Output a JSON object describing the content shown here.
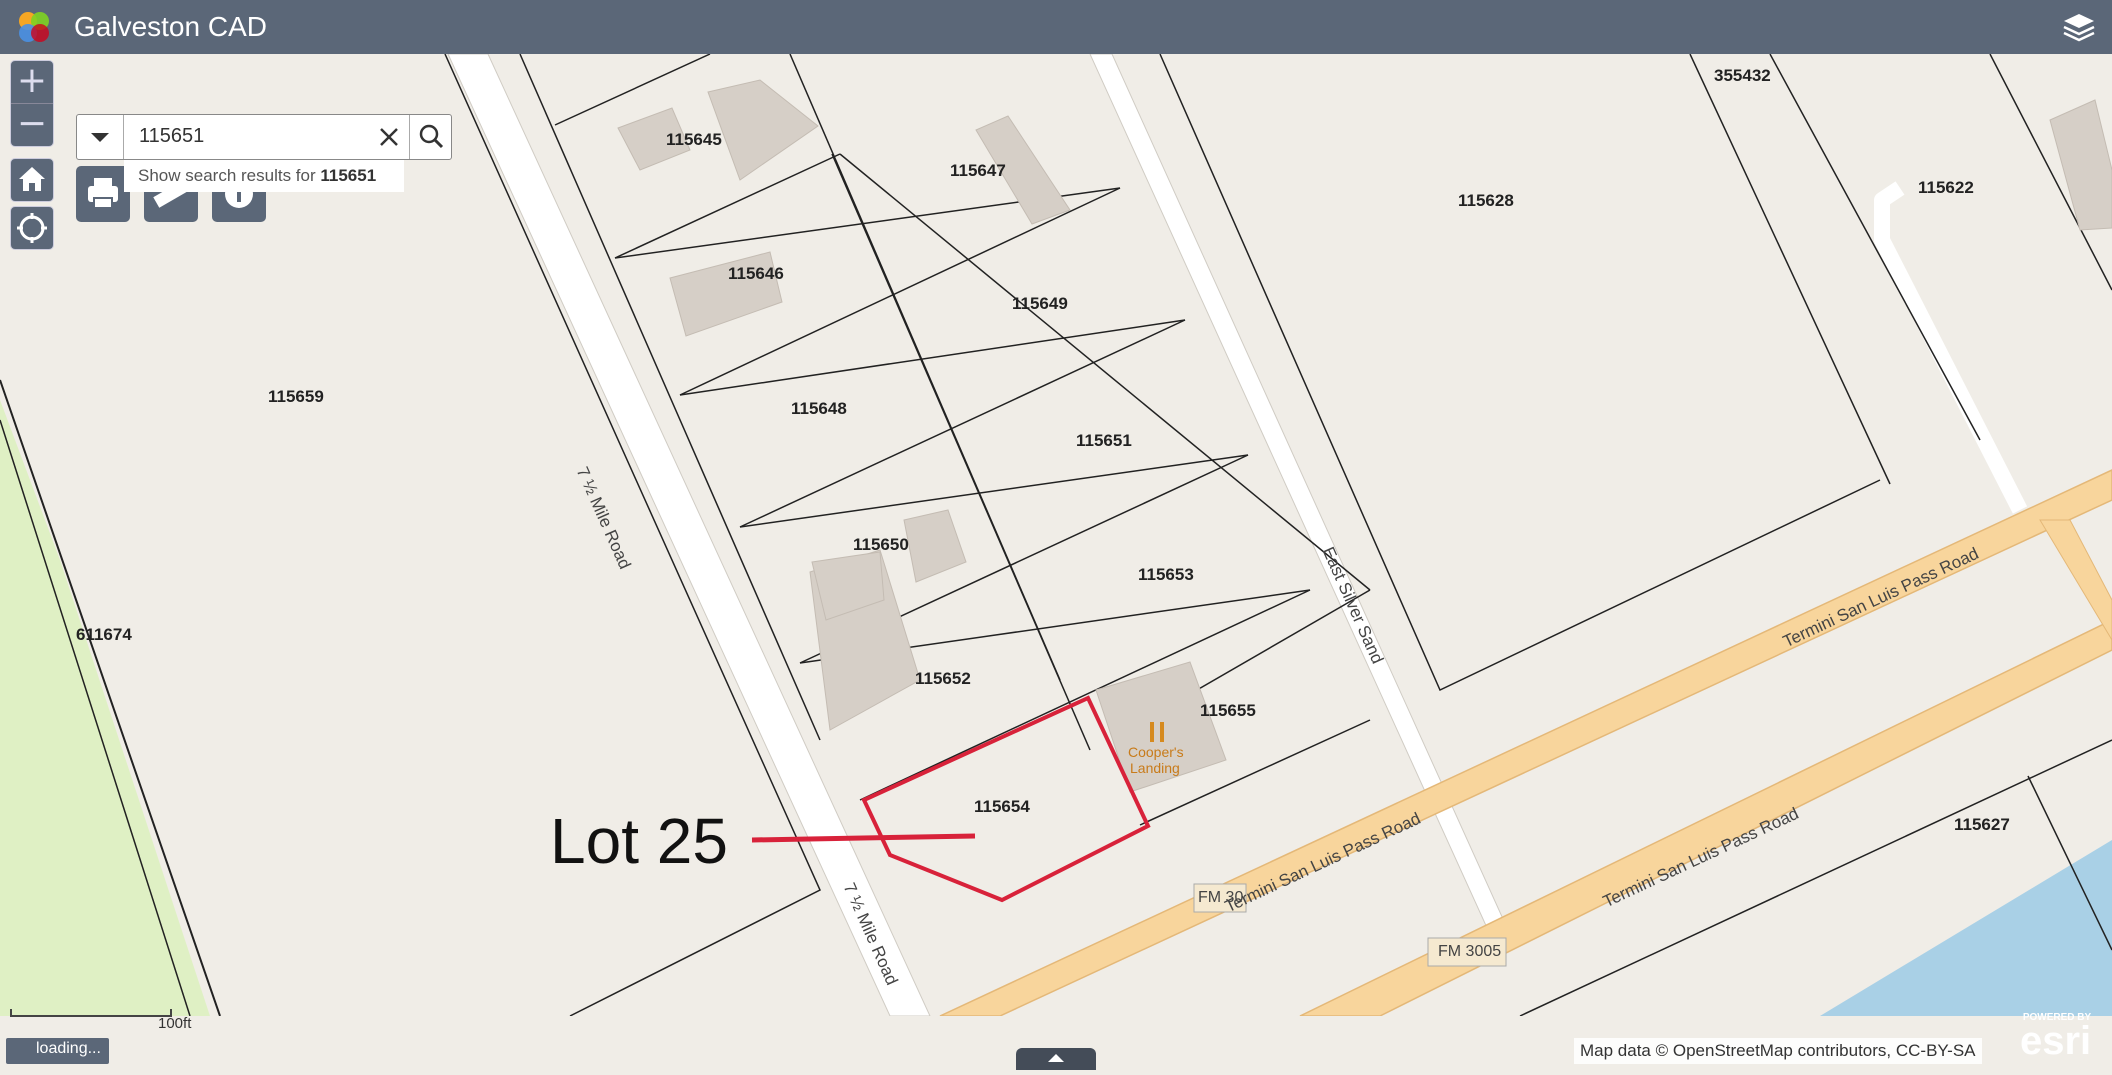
{
  "header": {
    "title": "Galveston CAD",
    "logo_icon": "cube-logo-icon",
    "layers_icon": "layers-icon"
  },
  "search": {
    "value": "115651",
    "suggestion_prefix": "Show search results for",
    "suggestion_term": "115651"
  },
  "map": {
    "parcels": [
      "115645",
      "115646",
      "115647",
      "115648",
      "115649",
      "115650",
      "115651",
      "115652",
      "115653",
      "115654",
      "115655",
      "115659",
      "611674",
      "115628",
      "355432",
      "115622",
      "115627"
    ],
    "roads": [
      "7 ½ Mile Road",
      "7 ½ Mile Road",
      "East Silver Sand",
      "Termini San Luis Pass Road",
      "Termini San Luis Pass Road",
      "Termini San Luis Pass Road"
    ],
    "shields": [
      "FM 3005",
      "FM 30"
    ],
    "poi": {
      "name_line1": "Cooper's",
      "name_line2": "Landing"
    },
    "annotation": "Lot 25",
    "scale_label": "100ft",
    "loading": "loading...",
    "attribution": "Map data © OpenStreetMap contributors, CC-BY-SA",
    "esri_powered": "POWERED BY",
    "esri": "esri"
  },
  "colors": {
    "header": "#5b6778",
    "land": "#f0ede7",
    "park": "#dff0c4",
    "water": "#a9d0e6",
    "major_road": "#f8d59c",
    "highlight": "#d8223a"
  }
}
